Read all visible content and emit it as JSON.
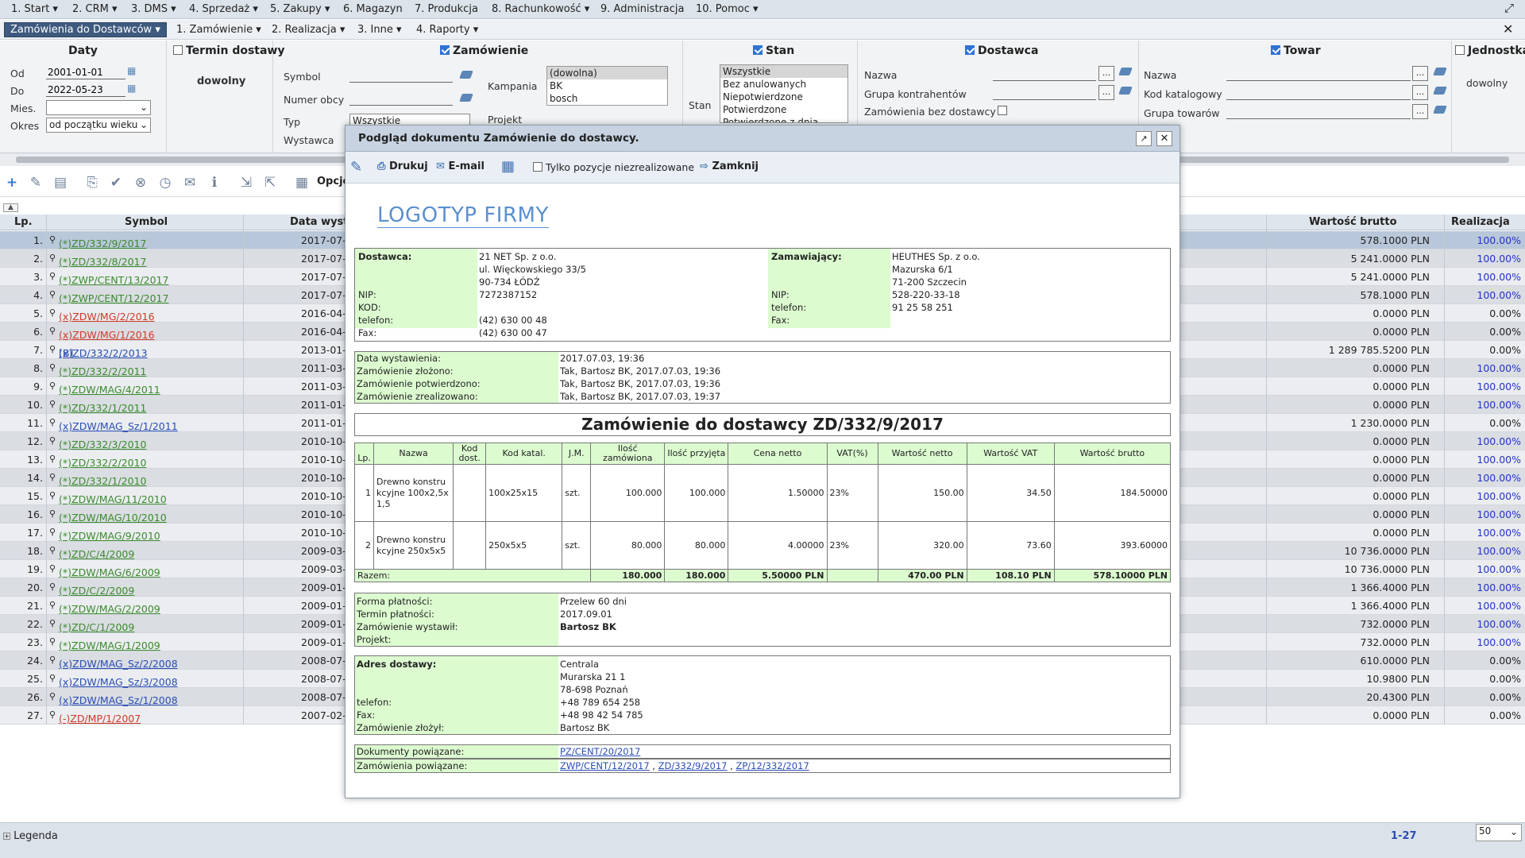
{
  "top_menu": [
    "1. Start ▾",
    "2. CRM ▾",
    "3. DMS ▾",
    "4. Sprzedaż ▾",
    "5. Zakupy ▾",
    "6. Magazyn",
    "7. Produkcja",
    "8. Rachunkowość ▾",
    "9. Administracja",
    "10. Pomoc ▾"
  ],
  "tabs": {
    "active": "Zamówienia do Dostawców ▾",
    "items": [
      "1. Zamówienie ▾",
      "2. Realizacja ▾",
      "3. Inne ▾",
      "4. Raporty ▾"
    ]
  },
  "filters": {
    "daty": {
      "title": "Daty",
      "od_label": "Od",
      "od": "2001-01-01",
      "do_label": "Do",
      "do": "2022-05-23",
      "mies_label": "Mies.",
      "mies": "",
      "okres_label": "Okres",
      "okres": "od początku wieku"
    },
    "termin": {
      "title": "Termin dostawy",
      "value": "dowolny"
    },
    "zamowienie": {
      "title": "Zamówienie",
      "symbol_label": "Symbol",
      "numer_label": "Numer obcy",
      "typ_label": "Typ",
      "typ": "Wszystkie",
      "wystawca_label": "Wystawca",
      "kampania_label": "Kampania",
      "kampania": [
        "(dowolna)",
        "BK",
        "bosch"
      ],
      "projekt_label": "Projekt"
    },
    "stan": {
      "title": "Stan",
      "label": "Stan",
      "items": [
        "Wszystkie",
        "Bez anulowanych",
        "Niepotwierdzone",
        "Potwierdzone",
        "Potwierdzone z dnia"
      ]
    },
    "dostawca": {
      "title": "Dostawca",
      "nazwa_label": "Nazwa",
      "grupa_label": "Grupa kontrahentów",
      "bez_label": "Zamówienia bez dostawcy"
    },
    "towar": {
      "title": "Towar",
      "nazwa_label": "Nazwa",
      "kod_label": "Kod katalogowy",
      "grupa_label": "Grupa towarów"
    },
    "jednostka": {
      "title": "Jednostka",
      "value": "dowolny"
    }
  },
  "toolbar": {
    "opcje": "Opcje"
  },
  "grid": {
    "headers": {
      "lp": "Lp.",
      "symbol": "Symbol",
      "data": "Data wyst",
      "brutto": "Wartość brutto",
      "realizacja": "Realizacja"
    },
    "rows": [
      {
        "lp": "1.",
        "prefix": "",
        "symbol": "(*)ZD/332/9/2017",
        "color": "g",
        "date": "2017-07-",
        "brutto": "578.1000 PLN",
        "real": "100.00%"
      },
      {
        "lp": "2.",
        "prefix": "",
        "symbol": "(*)ZD/332/8/2017",
        "color": "g",
        "date": "2017-07-",
        "brutto": "5 241.0000 PLN",
        "real": "100.00%"
      },
      {
        "lp": "3.",
        "prefix": "",
        "symbol": "(*)ZWP/CENT/13/2017",
        "color": "g",
        "date": "2017-07-",
        "brutto": "5 241.0000 PLN",
        "real": "100.00%"
      },
      {
        "lp": "4.",
        "prefix": "",
        "symbol": "(*)ZWP/CENT/12/2017",
        "color": "g",
        "date": "2017-07-",
        "brutto": "578.1000 PLN",
        "real": "100.00%"
      },
      {
        "lp": "5.",
        "prefix": "",
        "symbol": "(x)ZDW/MG/2/2016",
        "color": "r",
        "date": "2016-04-",
        "brutto": "0.0000 PLN",
        "real": "0.00%"
      },
      {
        "lp": "6.",
        "prefix": "",
        "symbol": "(x)ZDW/MG/1/2016",
        "color": "r",
        "date": "2016-04-",
        "brutto": "0.0000 PLN",
        "real": "0.00%"
      },
      {
        "lp": "7.",
        "prefix": "[B]",
        "symbol": "(x)ZD/332/2/2013",
        "color": "b",
        "date": "2013-01-",
        "brutto": "1 289 785.5200 PLN",
        "real": "0.00%"
      },
      {
        "lp": "8.",
        "prefix": "",
        "symbol": "(*)ZD/332/2/2011",
        "color": "g",
        "date": "2011-03-",
        "brutto": "0.0000 PLN",
        "real": "100.00%"
      },
      {
        "lp": "9.",
        "prefix": "",
        "symbol": "(*)ZDW/MAG/4/2011",
        "color": "g",
        "date": "2011-03-",
        "brutto": "0.0000 PLN",
        "real": "100.00%"
      },
      {
        "lp": "10.",
        "prefix": "",
        "symbol": "(*)ZD/332/1/2011",
        "color": "g",
        "date": "2011-01-",
        "brutto": "0.0000 PLN",
        "real": "100.00%"
      },
      {
        "lp": "11.",
        "prefix": "",
        "symbol": "(x)ZDW/MAG_Sz/1/2011",
        "color": "b",
        "date": "2011-01-",
        "brutto": "1 230.0000 PLN",
        "real": "0.00%"
      },
      {
        "lp": "12.",
        "prefix": "",
        "symbol": "(*)ZD/332/3/2010",
        "color": "g",
        "date": "2010-10-",
        "brutto": "0.0000 PLN",
        "real": "100.00%"
      },
      {
        "lp": "13.",
        "prefix": "",
        "symbol": "(*)ZD/332/2/2010",
        "color": "g",
        "date": "2010-10-",
        "brutto": "0.0000 PLN",
        "real": "100.00%"
      },
      {
        "lp": "14.",
        "prefix": "",
        "symbol": "(*)ZD/332/1/2010",
        "color": "g",
        "date": "2010-10-",
        "brutto": "0.0000 PLN",
        "real": "100.00%"
      },
      {
        "lp": "15.",
        "prefix": "",
        "symbol": "(*)ZDW/MAG/11/2010",
        "color": "g",
        "date": "2010-10-",
        "brutto": "0.0000 PLN",
        "real": "100.00%"
      },
      {
        "lp": "16.",
        "prefix": "",
        "symbol": "(*)ZDW/MAG/10/2010",
        "color": "g",
        "date": "2010-10-",
        "brutto": "0.0000 PLN",
        "real": "100.00%"
      },
      {
        "lp": "17.",
        "prefix": "",
        "symbol": "(*)ZDW/MAG/9/2010",
        "color": "g",
        "date": "2010-10-",
        "brutto": "0.0000 PLN",
        "real": "100.00%"
      },
      {
        "lp": "18.",
        "prefix": "",
        "symbol": "(*)ZD/C/4/2009",
        "color": "g",
        "date": "2009-03-",
        "brutto": "10 736.0000 PLN",
        "real": "100.00%"
      },
      {
        "lp": "19.",
        "prefix": "",
        "symbol": "(*)ZDW/MAG/6/2009",
        "color": "g",
        "date": "2009-03-",
        "brutto": "10 736.0000 PLN",
        "real": "100.00%"
      },
      {
        "lp": "20.",
        "prefix": "",
        "symbol": "(*)ZD/C/2/2009",
        "color": "g",
        "date": "2009-01-",
        "brutto": "1 366.4000 PLN",
        "real": "100.00%"
      },
      {
        "lp": "21.",
        "prefix": "",
        "symbol": "(*)ZDW/MAG/2/2009",
        "color": "g",
        "date": "2009-01-",
        "brutto": "1 366.4000 PLN",
        "real": "100.00%"
      },
      {
        "lp": "22.",
        "prefix": "",
        "symbol": "(*)ZD/C/1/2009",
        "color": "g",
        "date": "2009-01-",
        "brutto": "732.0000 PLN",
        "real": "100.00%"
      },
      {
        "lp": "23.",
        "prefix": "",
        "symbol": "(*)ZDW/MAG/1/2009",
        "color": "g",
        "date": "2009-01-",
        "brutto": "732.0000 PLN",
        "real": "100.00%"
      },
      {
        "lp": "24.",
        "prefix": "",
        "symbol": "(x)ZDW/MAG_Sz/2/2008",
        "color": "b",
        "date": "2008-07-",
        "brutto": "610.0000 PLN",
        "real": "0.00%"
      },
      {
        "lp": "25.",
        "prefix": "",
        "symbol": "(x)ZDW/MAG_Sz/3/2008",
        "color": "b",
        "date": "2008-07-",
        "brutto": "10.9800 PLN",
        "real": "0.00%"
      },
      {
        "lp": "26.",
        "prefix": "",
        "symbol": "(x)ZDW/MAG_Sz/1/2008",
        "color": "b",
        "date": "2008-07-",
        "brutto": "20.4300 PLN",
        "real": "0.00%"
      },
      {
        "lp": "27.",
        "prefix": "",
        "symbol": "(-)ZD/MP/1/2007",
        "color": "r",
        "date": "2007-02-",
        "brutto": "0.0000 PLN",
        "real": "0.00%"
      }
    ]
  },
  "footer": {
    "legenda": "Legenda",
    "range": "1-27",
    "page_size": "50"
  },
  "modal": {
    "title": "Podgląd dokumentu Zamówienie do dostawcy.",
    "toolbar": {
      "drukuj": "Drukuj",
      "email": "E-mail",
      "tylko": "Tylko pozycje niezrealizowane",
      "zamknij": "Zamknij"
    },
    "logo": "LOGOTYP FIRMY",
    "supplier": {
      "label": "Dostawca:",
      "lines": [
        "21 NET Sp. z o.o.",
        "ul. Więckowskiego 33/5",
        "90-734 ŁÓDŹ"
      ],
      "nip_l": "NIP:",
      "nip": "7272387152",
      "kod_l": "KOD:",
      "kod": "",
      "tel_l": "telefon:",
      "tel": "(42) 630 00 48",
      "fax_l": "Fax:",
      "fax": "(42) 630 00 47"
    },
    "buyer": {
      "label": "Zamawiający:",
      "lines": [
        "HEUTHES Sp. z o.o.",
        "Mazurska 6/1",
        "71-200 Szczecin"
      ],
      "nip_l": "NIP:",
      "nip": "528-220-33-18",
      "tel_l": "telefon:",
      "tel": "91 25 58 251",
      "fax_l": "Fax:",
      "fax": ""
    },
    "dates": [
      {
        "l": "Data wystawienia:",
        "v": "2017.07.03, 19:36"
      },
      {
        "l": "Zamówienie złożono:",
        "v": "Tak,  Bartosz BK,  2017.07.03, 19:36"
      },
      {
        "l": "Zamówienie potwierdzono:",
        "v": "Tak,  Bartosz BK,  2017.07.03, 19:36"
      },
      {
        "l": "Zamówienie zrealizowano:",
        "v": "Tak,  Bartosz BK,  2017.07.03, 19:37"
      }
    ],
    "doc_title": "Zamówienie do dostawcy ZD/332/9/2017",
    "items_head": [
      "Lp.",
      "Nazwa",
      "Kod dost.",
      "Kod katal.",
      "J.M.",
      "Ilość zamówiona",
      "Ilość przyjęta",
      "Cena netto",
      "VAT(%)",
      "Wartość netto",
      "Wartość VAT",
      "Wartość brutto"
    ],
    "items": [
      {
        "lp": "1",
        "nazwa": "Drewno konstrukcyjne 100x2,5x1,5",
        "kod": "",
        "katal": "100x25x15",
        "jm": "szt.",
        "zam": "100.000",
        "przyj": "100.000",
        "cena": "1.50000",
        "vat": "23%",
        "netto": "150.00",
        "wvat": "34.50",
        "brutto": "184.50000"
      },
      {
        "lp": "2",
        "nazwa": "Drewno konstrukcyjne 250x5x5",
        "kod": "",
        "katal": "250x5x5",
        "jm": "szt.",
        "zam": "80.000",
        "przyj": "80.000",
        "cena": "4.00000",
        "vat": "23%",
        "netto": "320.00",
        "wvat": "73.60",
        "brutto": "393.60000"
      }
    ],
    "totals": {
      "label": "Razem:",
      "zam": "180.000",
      "przyj": "180.000",
      "cena": "5.50000 PLN",
      "netto": "470.00 PLN",
      "vat": "108.10 PLN",
      "brutto": "578.10000 PLN"
    },
    "payment": [
      {
        "l": "Forma płatności:",
        "v": "Przelew 60 dni"
      },
      {
        "l": "Termin płatności:",
        "v": "2017.09.01"
      },
      {
        "l": "Zamówienie wystawił:",
        "v": "Bartosz BK"
      },
      {
        "l": "Projekt:",
        "v": ""
      }
    ],
    "delivery": {
      "label": "Adres dostawy:",
      "lines": [
        "Centrala",
        "Murarska 21 1",
        "78-698 Poznań"
      ],
      "tel_l": "telefon:",
      "tel": "+48 789 654 258",
      "fax_l": "Fax:",
      "fax": "+48 98 42 54 785",
      "zl_l": "Zamówienie złożył:",
      "zl": "Bartosz BK"
    },
    "related": {
      "docs_l": "Dokumenty powiązane:",
      "docs": "PZ/CENT/20/2017",
      "orders_l": "Zamówienia powiązane:",
      "orders": [
        "ZWP/CENT/12/2017",
        "ZD/332/9/2017",
        "ZP/12/332/2017"
      ]
    }
  }
}
